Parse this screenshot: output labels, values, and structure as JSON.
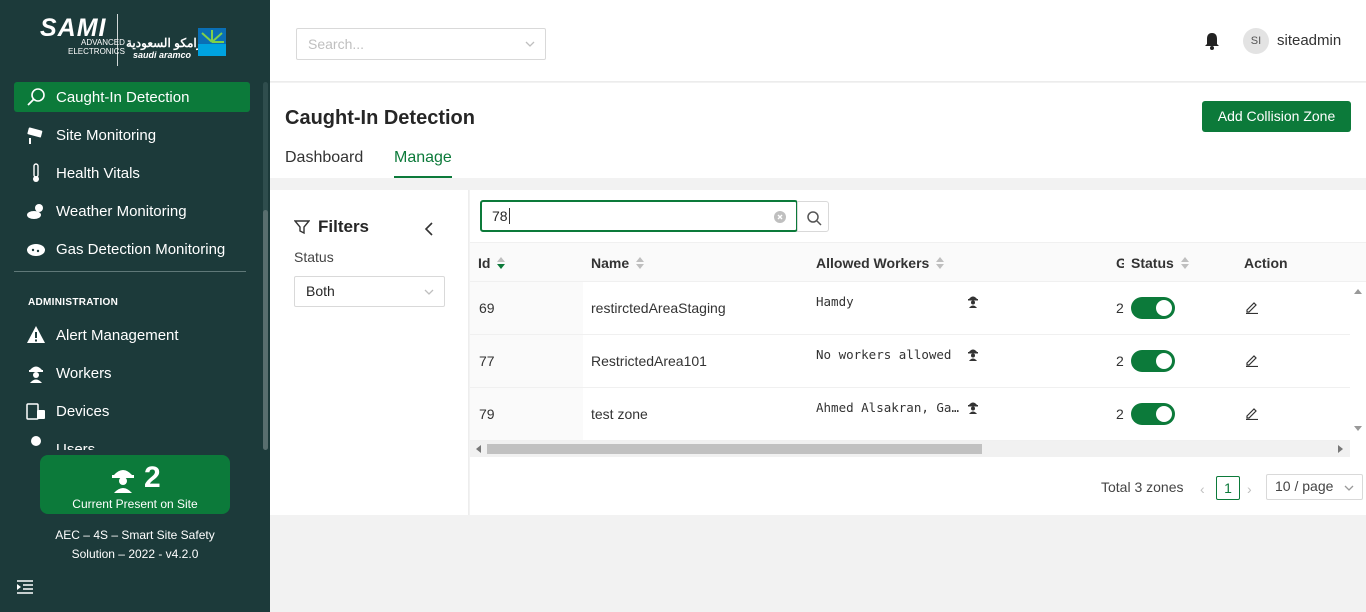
{
  "brand": {
    "sami": "SAMI",
    "sami_sub_1": "ADVANCED",
    "sami_sub_2": "ELECTRONICS",
    "aramco_ar": "أرامكو السعودية",
    "aramco_en": "saudi aramco"
  },
  "sidebar": {
    "items": [
      {
        "label": "Caught-In Detection",
        "icon": "search-icon"
      },
      {
        "label": "Site Monitoring",
        "icon": "cctv-camera-icon"
      },
      {
        "label": "Health Vitals",
        "icon": "thermometer-icon"
      },
      {
        "label": "Weather Monitoring",
        "icon": "weather-icon"
      },
      {
        "label": "Gas Detection Monitoring",
        "icon": "gas-cloud-icon"
      }
    ],
    "section_title": "ADMINISTRATION",
    "admin_items": [
      {
        "label": "Alert Management",
        "icon": "warning-icon"
      },
      {
        "label": "Workers",
        "icon": "worker-icon"
      },
      {
        "label": "Devices",
        "icon": "devices-icon"
      },
      {
        "label": "Users",
        "icon": "user-icon"
      }
    ],
    "present_count": "2",
    "present_label": "Current Present on Site",
    "version_line1": "AEC – 4S – Smart Site Safety",
    "version_line2": "Solution – 2022 - v4.2.0"
  },
  "header": {
    "search_placeholder": "Search...",
    "avatar_initials": "SI",
    "username": "siteadmin"
  },
  "page": {
    "title": "Caught-In Detection",
    "add_button": "Add Collision Zone",
    "tabs": [
      "Dashboard",
      "Manage"
    ],
    "active_tab": "Manage"
  },
  "filters": {
    "title": "Filters",
    "status_label": "Status",
    "status_value": "Both"
  },
  "table": {
    "search_value": "78",
    "columns": [
      "Id",
      "Name",
      "Allowed Workers",
      "G",
      "Status",
      "Action"
    ],
    "rows": [
      {
        "id": "69",
        "name": "restirctedAreaStaging",
        "workers": "Hamdy",
        "g": "2",
        "status": "on"
      },
      {
        "id": "77",
        "name": "RestrictedArea101",
        "workers": "No workers allowed",
        "g": "2",
        "status": "on"
      },
      {
        "id": "79",
        "name": "test zone",
        "workers": "Ahmed Alsakran, Ga…",
        "g": "2",
        "status": "on"
      }
    ]
  },
  "pagination": {
    "total": "Total 3 zones",
    "current_page": "1",
    "page_size": "10 / page"
  },
  "colors": {
    "sidebar_bg": "#1c3a3a",
    "accent": "#0c7a3a"
  }
}
